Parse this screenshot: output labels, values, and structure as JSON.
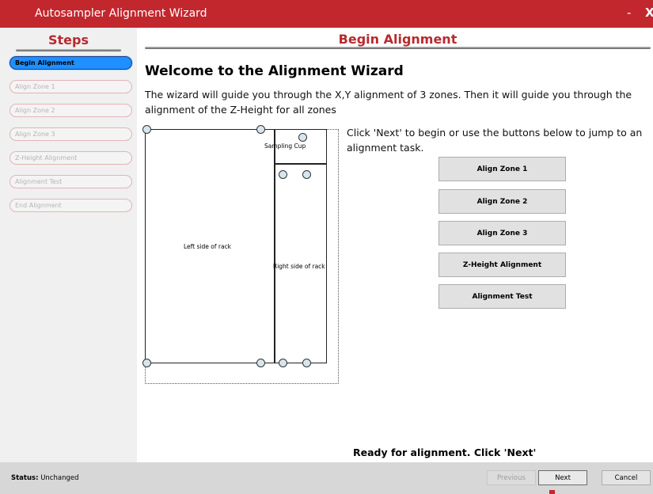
{
  "window": {
    "title": "Autosampler Alignment Wizard",
    "minimize": "-",
    "close": "X"
  },
  "sidebar": {
    "header": "Steps",
    "items": [
      {
        "label": "Begin Alignment"
      },
      {
        "label": "Align Zone 1"
      },
      {
        "label": "Align Zone 2"
      },
      {
        "label": "Align Zone 3"
      },
      {
        "label": "Z-Height Alignment"
      },
      {
        "label": "Alignment Test"
      },
      {
        "label": "End Alignment"
      }
    ]
  },
  "main": {
    "header": "Begin Alignment",
    "welcome": "Welcome to the Alignment Wizard",
    "description": "The wizard will guide you through the X,Y alignment of 3 zones. Then it will guide you through the alignment of the Z-Height for all zones",
    "instructions": "Click 'Next' to begin or use the buttons below to jump to an alignment task.",
    "rack": {
      "left_label": "Left side of rack",
      "cup_label": "Sampling Cup",
      "right_label": "Right side of rack"
    },
    "buttons": [
      "Align Zone 1",
      "Align Zone 2",
      "Align Zone 3",
      "Z-Height Alignment",
      "Alignment Test"
    ],
    "ready": "Ready for alignment. Click 'Next'"
  },
  "statusbar": {
    "status_label": "Status:",
    "status_value": "Unchanged",
    "previous": "Previous",
    "next": "Next",
    "cancel": "Cancel"
  },
  "colors": {
    "titlebar": "#c1272d",
    "accent": "#b72a2f",
    "active_step": "#1e90ff"
  }
}
